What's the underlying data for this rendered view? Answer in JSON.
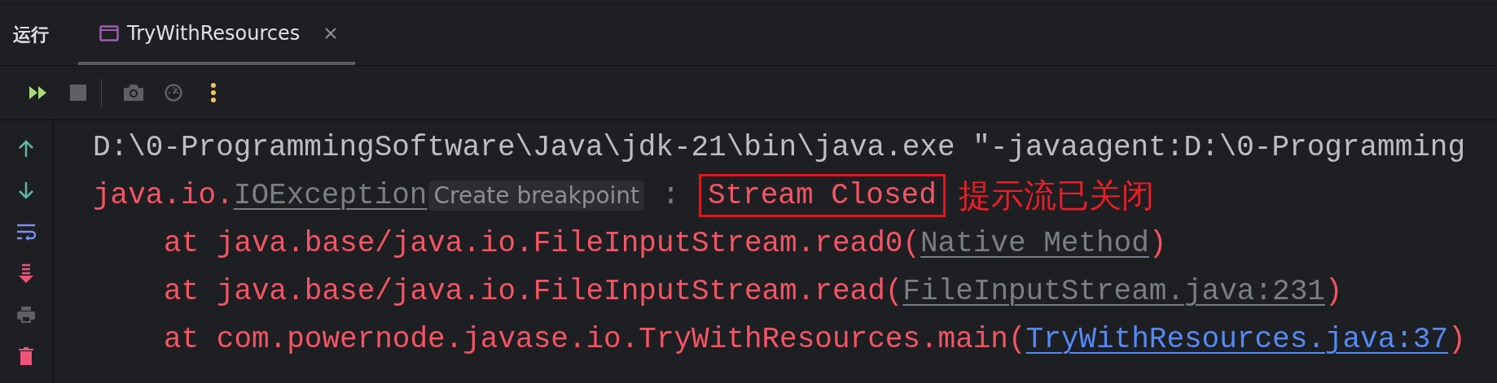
{
  "run_panel": {
    "title": "运行",
    "tabs": [
      {
        "label": "TryWithResources",
        "selected": true
      }
    ]
  },
  "console": {
    "lines": [
      {
        "indented": false,
        "segments": [
          {
            "kind": "plain",
            "text": "D:\\0-ProgrammingSoftware\\Java\\jdk-21\\bin\\java.exe \"-javaagent:D:\\0-Programming"
          }
        ]
      },
      {
        "indented": false,
        "segments": [
          {
            "kind": "error",
            "text": "java.io."
          },
          {
            "kind": "link_grey",
            "text": "IOException"
          },
          {
            "kind": "hint",
            "text": "Create breakpoint"
          },
          {
            "kind": "plain_grey",
            "text": " : "
          },
          {
            "kind": "boxed",
            "text": "Stream Closed"
          },
          {
            "kind": "note",
            "text": "提示流已关闭"
          }
        ]
      },
      {
        "indented": true,
        "segments": [
          {
            "kind": "error",
            "text": "at java.base/java.io.FileInputStream.read0("
          },
          {
            "kind": "link_grey",
            "text": "Native Method"
          },
          {
            "kind": "error",
            "text": ")"
          }
        ]
      },
      {
        "indented": true,
        "segments": [
          {
            "kind": "error",
            "text": "at java.base/java.io.FileInputStream.read("
          },
          {
            "kind": "link_grey",
            "text": "FileInputStream.java:231"
          },
          {
            "kind": "error",
            "text": ")"
          }
        ]
      },
      {
        "indented": true,
        "segments": [
          {
            "kind": "error",
            "text": "at com.powernode.javase.io.TryWithResources.main("
          },
          {
            "kind": "link_blue",
            "text": "TryWithResources.java:37"
          },
          {
            "kind": "error",
            "text": ")"
          }
        ]
      }
    ]
  }
}
